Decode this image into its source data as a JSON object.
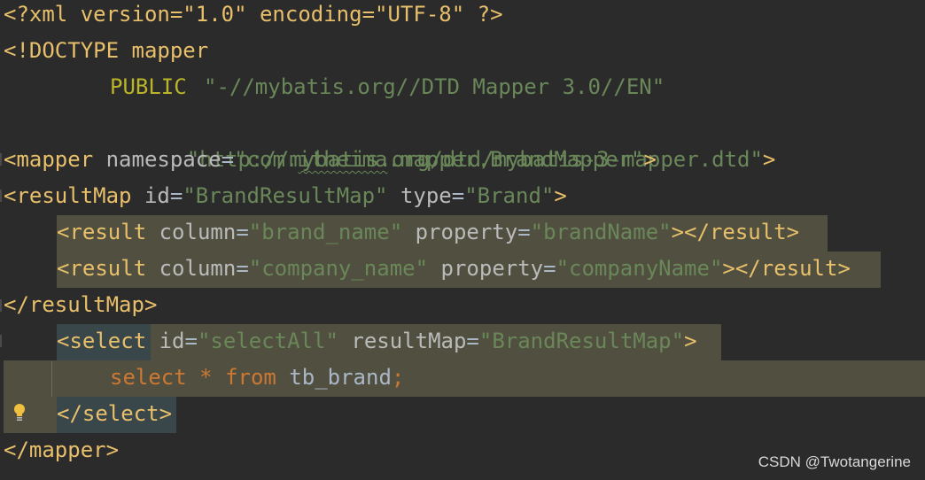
{
  "lines": {
    "l1": {
      "text": "<?xml version=\"1.0\" encoding=\"UTF-8\" ?>"
    },
    "l2": {
      "text": "<!DOCTYPE mapper"
    },
    "l3": {
      "public": "PUBLIC",
      "value": "\"-//mybatis.org//DTD Mapper 3.0//EN\""
    },
    "l4": {
      "value": "\"http://mybatis.org/dtd/mybatis-3-mapper.dtd\"",
      "close": ">"
    },
    "l5": {
      "open": "<mapper",
      "attr": "namespace",
      "eq": "=",
      "v1": "\"com.",
      "v2": "itheima",
      "v3": ".mapper.BrandMapper\"",
      "close": ">"
    },
    "l6": {
      "open": "<resultMap",
      "attr1": "id",
      "eq1": "=",
      "val1": "\"BrandResultMap\"",
      "attr2": "type",
      "eq2": "=",
      "val2": "\"Brand\"",
      "close": ">"
    },
    "l7": {
      "open": "<result",
      "attr1": "column",
      "eq1": "=",
      "val1": "\"brand_name\"",
      "attr2": "property",
      "eq2": "=",
      "val2": "\"brandName\"",
      "close": "></result>"
    },
    "l8": {
      "open": "<result",
      "attr1": "column",
      "eq1": "=",
      "val1": "\"company_name\"",
      "attr2": "property",
      "eq2": "=",
      "val2": "\"companyName\"",
      "close": "></result>"
    },
    "l9": {
      "text": "</resultMap>"
    },
    "l10": {
      "open": "<select",
      "attr1": "id",
      "eq1": "=",
      "val1": "\"selectAll\"",
      "attr2": "resultMap",
      "eq2": "=",
      "val2": "\"BrandResultMap\"",
      "close": ">"
    },
    "l11": {
      "kw1": "select",
      "star": "*",
      "kw2": "from",
      "table": "tb_brand",
      "semi": ";"
    },
    "l12": {
      "text": "</select>"
    },
    "l13": {
      "text": "</mapper>"
    }
  },
  "watermark": "CSDN @Twotangerine",
  "colors": {
    "background": "#2b2b2b",
    "tag": "#e8bf6a",
    "attribute": "#bababa",
    "string": "#6a8759",
    "keyword": "#cc7832",
    "selection": "#515040"
  }
}
